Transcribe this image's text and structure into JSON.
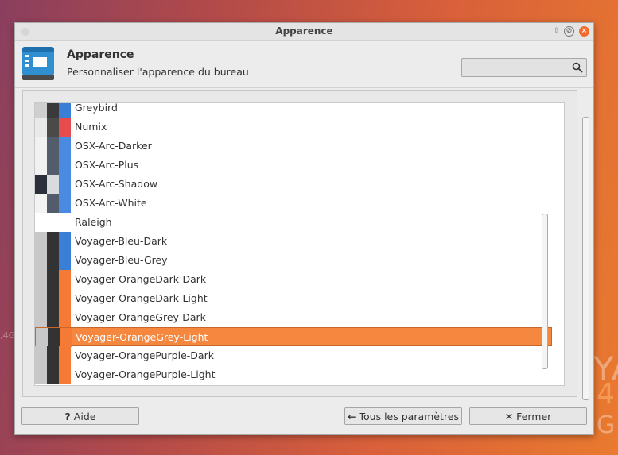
{
  "window": {
    "title": "Apparence"
  },
  "header": {
    "title": "Apparence",
    "subtitle": "Personnaliser l'apparence du bureau",
    "search_placeholder": ""
  },
  "desktop": {
    "text_left": ",4G",
    "text_right_1": "YA",
    "text_right_2": "4",
    "text_right_3": "G"
  },
  "themes": [
    {
      "name": "Greybird",
      "swatches": [
        "#cfcfcf",
        "#3a3a3a",
        "#3b7ed6"
      ]
    },
    {
      "name": "Numix",
      "swatches": [
        "#e9e9e9",
        "#4a4a4a",
        "#e84b4b"
      ]
    },
    {
      "name": "OSX-Arc-Darker",
      "swatches": [
        "#f1f1f1",
        "#535c6a",
        "#4a8ae0"
      ]
    },
    {
      "name": "OSX-Arc-Plus",
      "swatches": [
        "#f1f1f1",
        "#535c6a",
        "#4a8ae0"
      ]
    },
    {
      "name": "OSX-Arc-Shadow",
      "swatches": [
        "#2b303b",
        "#d9dbde",
        "#4a8ae0"
      ]
    },
    {
      "name": "OSX-Arc-White",
      "swatches": [
        "#f3f3f3",
        "#535c6a",
        "#4a8ae0"
      ]
    },
    {
      "name": "Raleigh",
      "swatches": [
        "#ffffff",
        "#ffffff",
        "#ffffff"
      ]
    },
    {
      "name": "Voyager-Bleu-Dark",
      "swatches": [
        "#c8c8c8",
        "#333333",
        "#3b7ed6"
      ]
    },
    {
      "name": "Voyager-Bleu-Grey",
      "swatches": [
        "#c8c8c8",
        "#333333",
        "#3b7ed6"
      ]
    },
    {
      "name": "Voyager-OrangeDark-Dark",
      "swatches": [
        "#c8c8c8",
        "#333333",
        "#f47a36"
      ]
    },
    {
      "name": "Voyager-OrangeDark-Light",
      "swatches": [
        "#c8c8c8",
        "#333333",
        "#f47a36"
      ]
    },
    {
      "name": "Voyager-OrangeGrey-Dark",
      "swatches": [
        "#c8c8c8",
        "#333333",
        "#f47a36"
      ]
    },
    {
      "name": "Voyager-OrangeGrey-Light",
      "swatches": [
        "#c8c8c8",
        "#333333",
        "#f47a36"
      ],
      "selected": true
    },
    {
      "name": "Voyager-OrangePurple-Dark",
      "swatches": [
        "#c8c8c8",
        "#333333",
        "#f47a36"
      ]
    },
    {
      "name": "Voyager-OrangePurple-Light",
      "swatches": [
        "#c8c8c8",
        "#333333",
        "#f47a36"
      ]
    }
  ],
  "buttons": {
    "help": {
      "icon": "question-icon",
      "label": "Aide"
    },
    "all_settings": {
      "icon": "arrow-left-icon",
      "label": "Tous les paramètres"
    },
    "close": {
      "icon": "close-x-icon",
      "label": "Fermer"
    }
  },
  "colors": {
    "accent": "#f5883e",
    "close_button": "#f26b2d",
    "app_icon": "#2f8fd1"
  }
}
